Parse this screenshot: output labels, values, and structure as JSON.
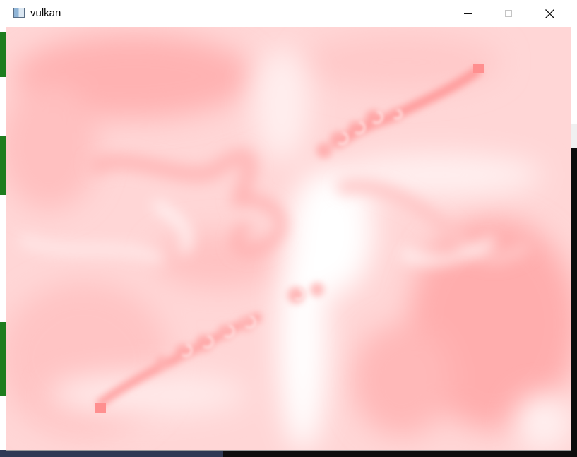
{
  "window": {
    "title": "vulkan",
    "icon": "app-window-icon",
    "controls": {
      "minimize_icon": "minimize-icon",
      "maximize_icon": "maximize-icon",
      "close_icon": "close-icon"
    }
  },
  "render": {
    "content": "fluid-simulation",
    "colors": {
      "base": "#ffd3d3",
      "dark": "#ff9a9a",
      "light": "#ffffff",
      "emitter": "#ff8f8f"
    }
  }
}
